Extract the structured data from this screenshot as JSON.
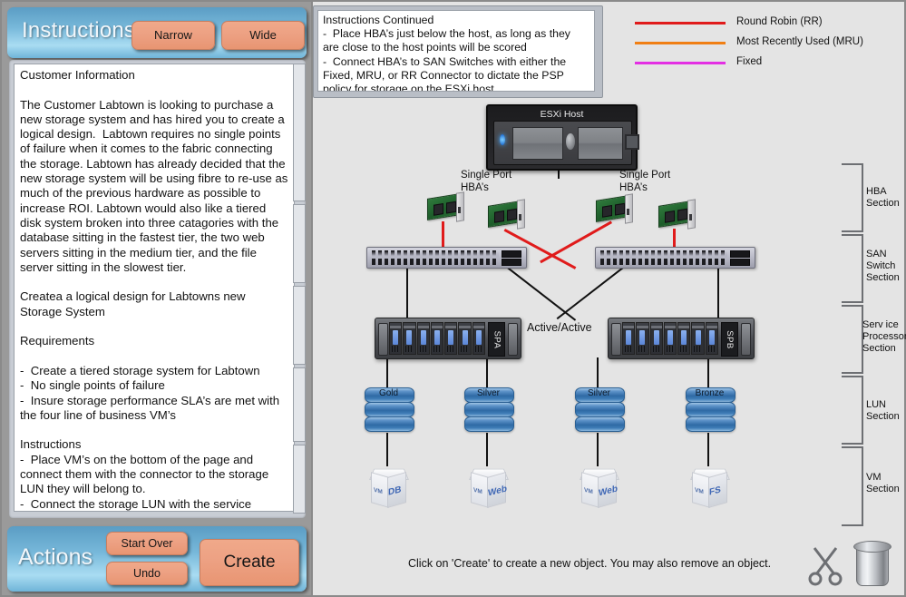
{
  "left_panel": {
    "instructions_header": {
      "title": "Instructions",
      "narrow_button": "Narrow",
      "wide_button": "Wide"
    },
    "instructions_text": "Customer Information\n\nThe Customer Labtown is looking to purchase a new storage system and has hired you to create a logical design.  Labtown requires no single points of failure when it comes to the fabric connecting the storage. Labtown has already decided that the new storage system will be using fibre to re-use as much of the previous hardware as possible to increase ROI. Labtown would also like a tiered disk system broken into three catagories with the database sitting in the fastest tier, the two web servers sitting in the medium tier, and the file server sitting in the slowest tier.\n\nCreatea a logical design for Labtowns new Storage System\n\nRequirements\n\n-  Create a tiered storage system for Labtown\n-  No single points of failure\n-  Insure storage performance SLA’s are met with the four line of business VM’s\n\nInstructions\n-  Place VM’s on the bottom of the page and connect them with the connector to the storage LUN they will belong to.\n-  Connect the storage LUN with the service processor with the connector\n-  Connect the storage processors to the SAN switch",
    "actions_header": {
      "title": "Actions",
      "start_over_button": "Start Over",
      "undo_button": "Undo",
      "create_button": "Create"
    }
  },
  "canvas": {
    "instructions_continued": "Instructions Continued\n-  Place HBA’s just below the host, as long as they are close to the host points will be scored\n-  Connect HBA’s to SAN Switches with either the Fixed, MRU, or RR Connector to dictate the PSP policy for storage on the ESXi host.",
    "legend": [
      {
        "label": "Round Robin (RR)",
        "color": "#e01b1b"
      },
      {
        "label": "Most Recently Used (MRU)",
        "color": "#f07f14"
      },
      {
        "label": "Fixed",
        "color": "#e32fe3"
      }
    ],
    "esxi_host": {
      "title": "ESXi Host"
    },
    "hba_labels": [
      "Single Port\nHBA’s",
      "Single Port\nHBA’s"
    ],
    "storage_processors": [
      {
        "tag": "SPA"
      },
      {
        "tag": "SPB"
      }
    ],
    "active_active_label": "Active/Active",
    "luns": [
      {
        "label": "Gold"
      },
      {
        "label": "Silver"
      },
      {
        "label": "Silver"
      },
      {
        "label": "Bronze"
      }
    ],
    "vms": [
      {
        "prefix": "VM",
        "name": "DB"
      },
      {
        "prefix": "VM",
        "name": "Web"
      },
      {
        "prefix": "VM",
        "name": "Web"
      },
      {
        "prefix": "VM",
        "name": "FS"
      }
    ],
    "sections": [
      {
        "label": "HBA\nSection"
      },
      {
        "label": "SAN\nSwitch\nSection"
      },
      {
        "label": "Serv ice\nProcessor\nSection"
      },
      {
        "label": "LUN\nSection"
      },
      {
        "label": "VM\nSection"
      }
    ],
    "bottom_note": "Click on 'Create' to create a new object.  You may also remove an object.",
    "tools": [
      {
        "name": "scissors-icon"
      },
      {
        "name": "trash-icon"
      }
    ]
  }
}
